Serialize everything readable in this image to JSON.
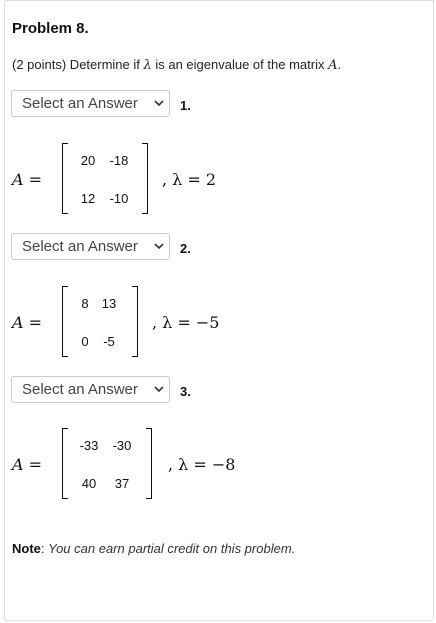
{
  "problem": {
    "title": "Problem 8.",
    "intro_prefix": "(2 points) Determine if ",
    "intro_lambda": "λ",
    "intro_middle": " is an eigenvalue of the matrix ",
    "intro_matrix": "A",
    "intro_end": "."
  },
  "select_placeholder": "Select an Answer",
  "parts": [
    {
      "number": "1.",
      "lhs": "A =",
      "matrix": [
        [
          "20",
          "-18"
        ],
        [
          "12",
          "-10"
        ]
      ],
      "rhs": ", λ = 2"
    },
    {
      "number": "2.",
      "lhs": "A =",
      "matrix": [
        [
          "8",
          "13"
        ],
        [
          "0",
          "-5"
        ]
      ],
      "rhs": ", λ = −5"
    },
    {
      "number": "3.",
      "lhs": "A =",
      "matrix": [
        [
          "-33",
          "-30"
        ],
        [
          "40",
          "37"
        ]
      ],
      "rhs": ", λ = −8"
    }
  ],
  "note": {
    "label": "Note",
    "separator": ": ",
    "text": "You can earn partial credit on this problem."
  }
}
